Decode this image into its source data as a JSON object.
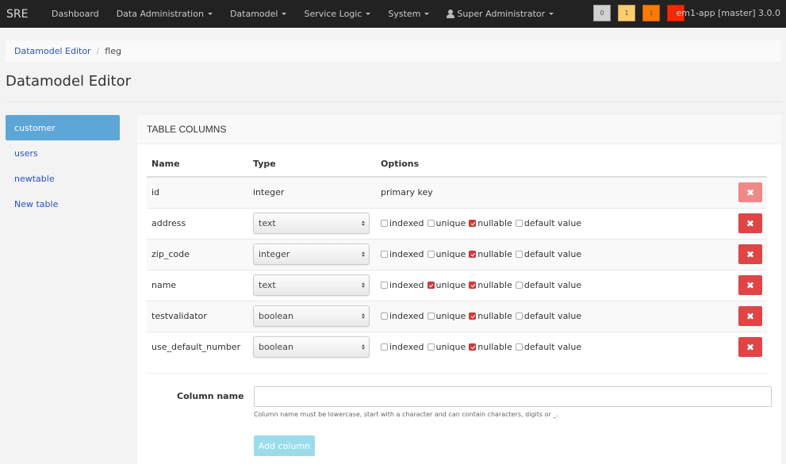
{
  "navbar": {
    "brand": "SRE",
    "items": [
      {
        "label": "Dashboard",
        "dropdown": false
      },
      {
        "label": "Data Administration",
        "dropdown": true
      },
      {
        "label": "Datamodel",
        "dropdown": true
      },
      {
        "label": "Service Logic",
        "dropdown": true
      },
      {
        "label": "System",
        "dropdown": true
      }
    ],
    "user": {
      "label": "Super Administrator",
      "icon": "user-icon"
    },
    "badges": [
      {
        "value": "0",
        "color": "#d0d0d0"
      },
      {
        "value": "1",
        "color": "#ffcc70"
      },
      {
        "value": "1",
        "color": "#ff7b00"
      },
      {
        "value": "0",
        "color": "#ff2600"
      }
    ],
    "app_version": "em1-app [master] 3.0.0"
  },
  "breadcrumb": {
    "link": "Datamodel Editor",
    "separator": "/",
    "current": "fleg"
  },
  "page_title": "Datamodel Editor",
  "sidebar": {
    "items": [
      {
        "label": "customer",
        "active": true
      },
      {
        "label": "users",
        "active": false
      },
      {
        "label": "newtable",
        "active": false
      },
      {
        "label": "New table",
        "active": false
      }
    ]
  },
  "panel": {
    "heading": "TABLE COLUMNS",
    "headers": {
      "name": "Name",
      "type": "Type",
      "options": "Options"
    },
    "option_labels": {
      "indexed": "indexed",
      "unique": "unique",
      "nullable": "nullable",
      "default": "default value"
    },
    "primary_row": {
      "name": "id",
      "type": "integer",
      "options": "primary key"
    },
    "rows": [
      {
        "name": "address",
        "type": "text",
        "indexed": false,
        "unique": false,
        "nullable": true,
        "default": false
      },
      {
        "name": "zip_code",
        "type": "integer",
        "indexed": false,
        "unique": false,
        "nullable": true,
        "default": false
      },
      {
        "name": "name",
        "type": "text",
        "indexed": false,
        "unique": true,
        "nullable": true,
        "default": false
      },
      {
        "name": "testvalidator",
        "type": "boolean",
        "indexed": false,
        "unique": false,
        "nullable": true,
        "default": false
      },
      {
        "name": "use_default_number",
        "type": "boolean",
        "indexed": false,
        "unique": false,
        "nullable": true,
        "default": false
      }
    ],
    "delete_icon": "✖",
    "form": {
      "label": "Column name",
      "value": "",
      "placeholder": "",
      "help": "Column name must be lowercase, start with a character and can contain characters, digits or _.",
      "button": "Add column"
    }
  }
}
